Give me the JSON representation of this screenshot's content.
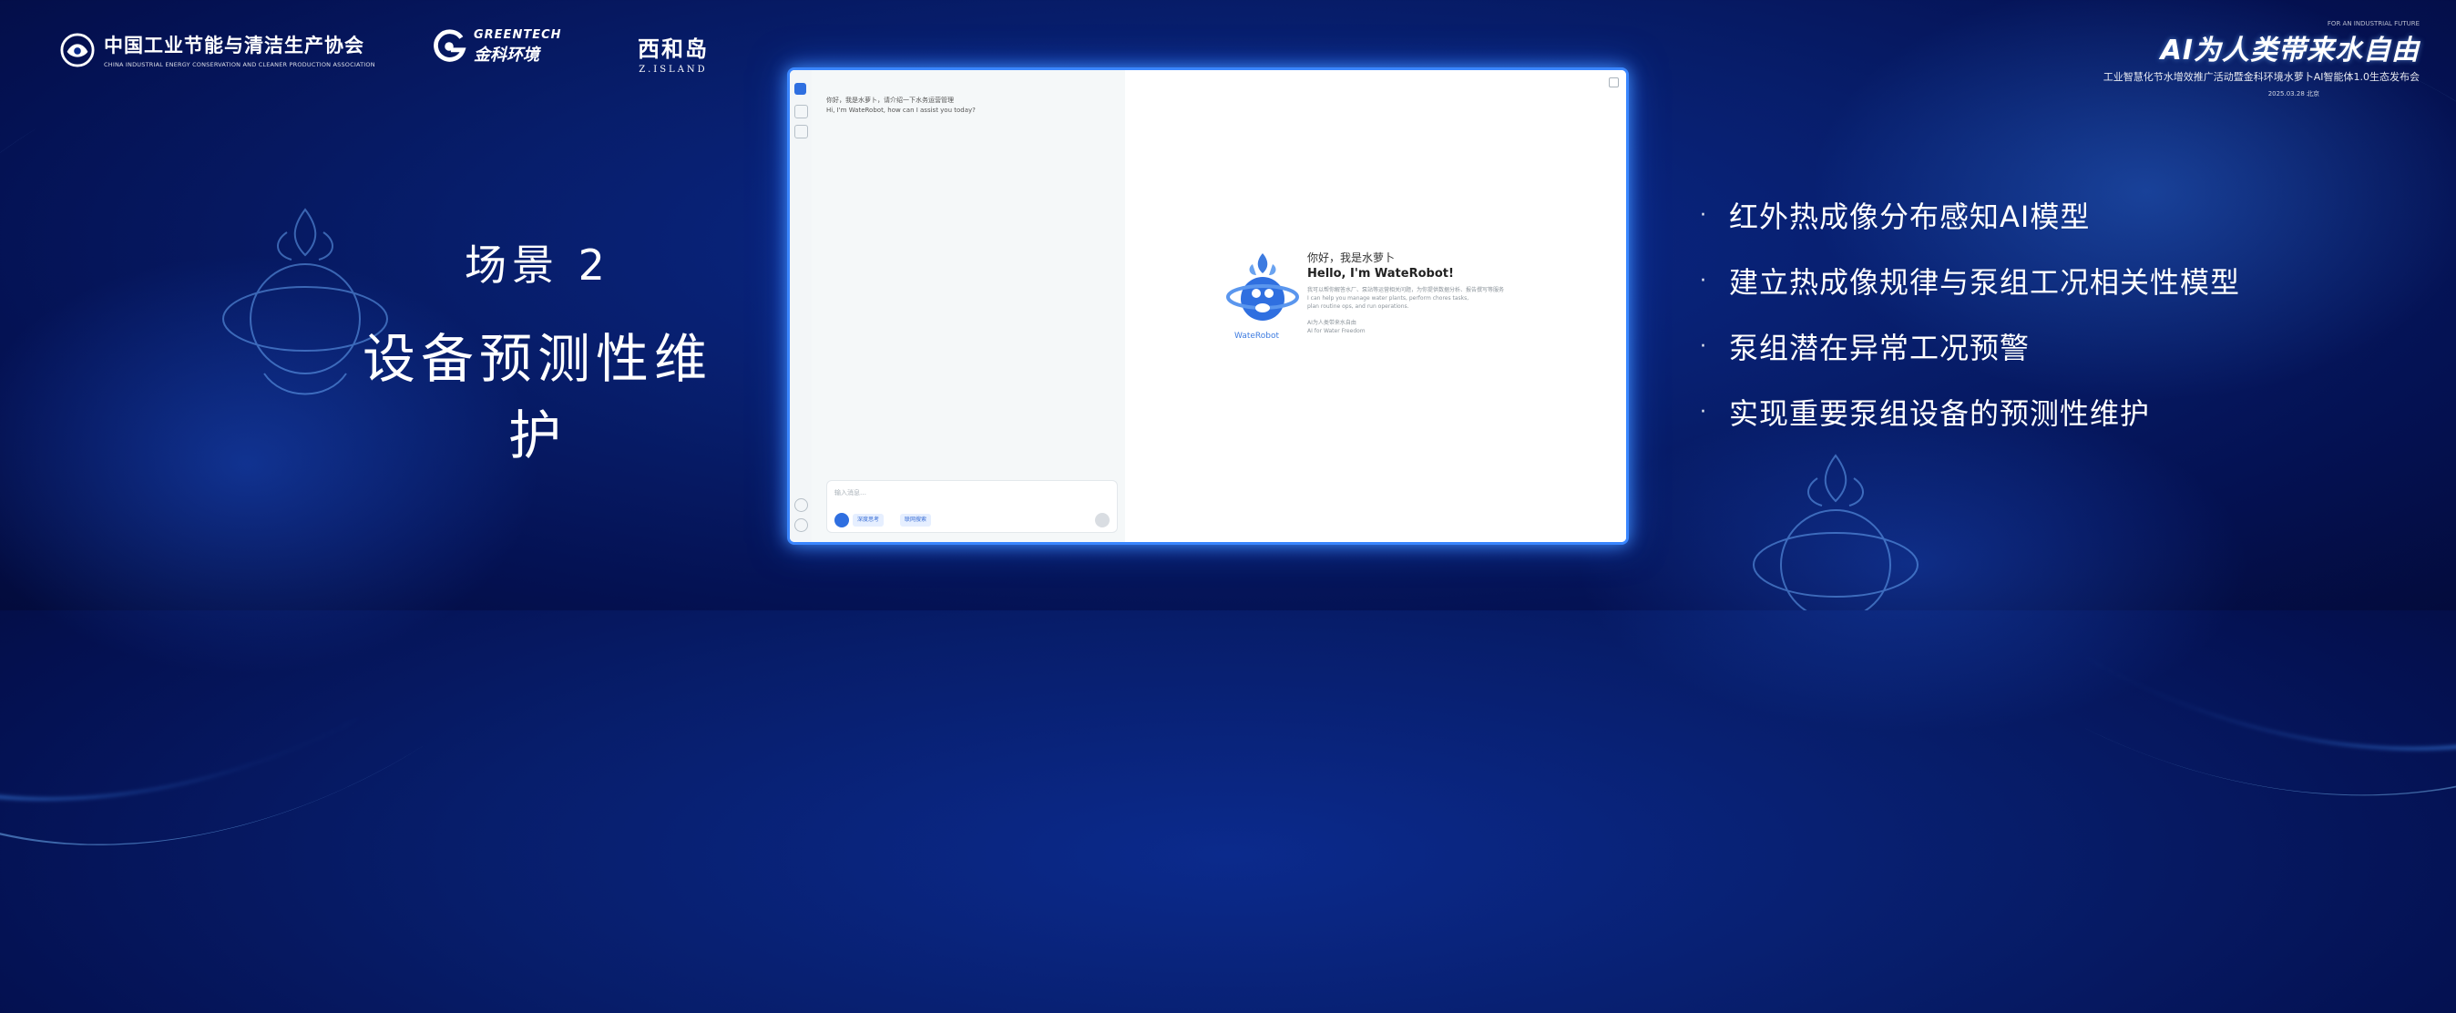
{
  "logos": {
    "ciecpa": {
      "cn": "中国工业节能与清洁生产协会",
      "en": "CHINA INDUSTRIAL ENERGY CONSERVATION AND CLEANER PRODUCTION ASSOCIATION"
    },
    "greentech": {
      "en": "GREENTECH",
      "cn": "金科环境"
    },
    "zisland": {
      "cn": "西和岛",
      "en": "Z.ISLAND"
    }
  },
  "event": {
    "pre": "FOR AN INDUSTRIAL FUTURE",
    "title": "AI为人类带来水自由",
    "subtitle": "工业智慧化节水增效推广活动暨金科环境水萝卜AI智能体1.0生态发布会",
    "date": "2025.03.28 北京"
  },
  "scene": {
    "number": "场景 2",
    "name": "设备预测性维护"
  },
  "bullets": [
    "红外热成像分布感知AI模型",
    "建立热成像规律与泵组工况相关性模型",
    "泵组潜在异常工况预警",
    "实现重要泵组设备的预测性维护"
  ],
  "app": {
    "chat_messages": [
      "你好，我是水萝卜，请介绍一下水务运营管理",
      "Hi, I'm WateRobot, how can I assist you today?"
    ],
    "input_placeholder": "输入消息…",
    "chips": [
      "深度思考",
      "联网搜索"
    ],
    "welcome_cn": "你好，我是水萝卜",
    "welcome_en": "Hello, I'm WateRobot!",
    "welcome_desc": [
      "我可以帮你解答水厂、泵站等运营相关问题，为你提供数据分析、报告撰写等服务",
      "I can help you manage water plants, perform chores tasks,",
      "plan routine ops, and run operations.",
      "",
      "AI为人类带来水自由",
      "AI for Water Freedom"
    ],
    "robot_name": "WateRobot"
  }
}
